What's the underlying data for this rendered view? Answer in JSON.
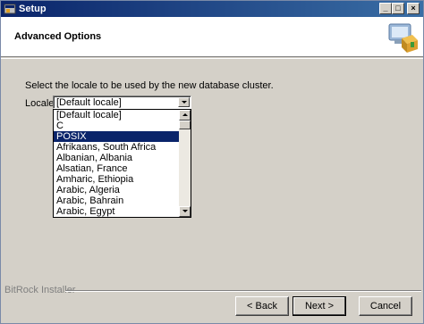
{
  "window": {
    "title": "Setup"
  },
  "titlebar_buttons": {
    "minimize": "_",
    "maximize": "□",
    "close": "×"
  },
  "header": {
    "title": "Advanced Options"
  },
  "main": {
    "instruction": "Select the locale to be used by the new database cluster.",
    "locale_label": "Locale",
    "locale_value": "[Default locale]",
    "locale_options": [
      "[Default locale]",
      "C",
      "POSIX",
      "Afrikaans, South Africa",
      "Albanian, Albania",
      "Alsatian, France",
      "Amharic, Ethiopia",
      "Arabic, Algeria",
      "Arabic, Bahrain",
      "Arabic, Egypt"
    ],
    "selected_option": "POSIX"
  },
  "footer": {
    "brand": "BitRock Installer",
    "back_label": "< Back",
    "next_label": "Next >",
    "cancel_label": "Cancel"
  },
  "colors": {
    "titlebar": "#0a246a",
    "selection": "#0a246a",
    "face": "#d4d0c8"
  },
  "icons": {
    "app": "setup-app-icon",
    "header": "installer-box-icon"
  }
}
